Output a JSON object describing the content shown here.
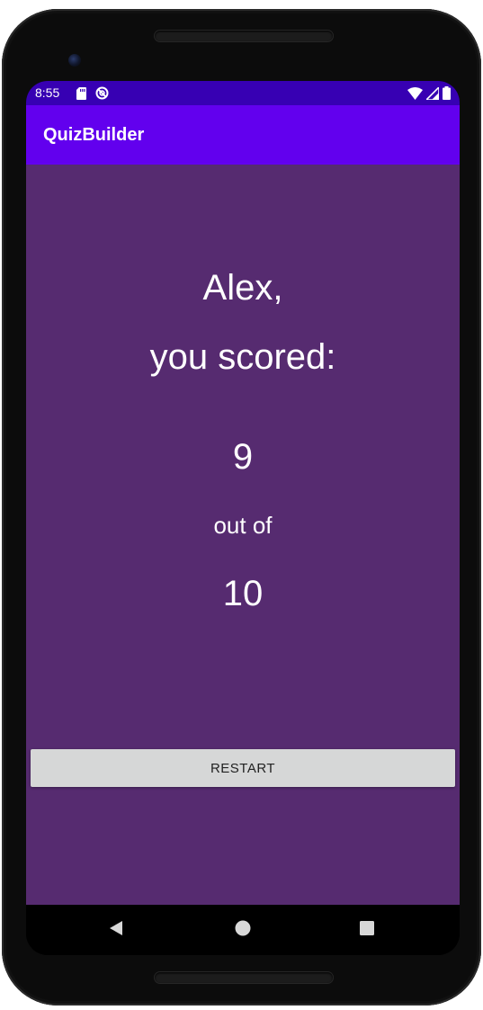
{
  "theme": {
    "status_bar_color": "#3700b3",
    "app_bar_color": "#6200ee",
    "content_color": "#562b70",
    "button_color": "#d6d7d7"
  },
  "status_bar": {
    "time": "8:55",
    "left_icons": [
      "sd-card-icon",
      "do-not-disturb-icon"
    ],
    "right_icons": [
      "wifi-icon",
      "signal-icon",
      "battery-icon"
    ]
  },
  "app_bar": {
    "title": "QuizBuilder"
  },
  "result": {
    "name_line": "Alex,",
    "scored_line": "you scored:",
    "score": "9",
    "out_of": "out of",
    "total": "10"
  },
  "actions": {
    "restart_label": "RESTART"
  },
  "nav_bar": {
    "buttons": [
      "back-icon",
      "home-icon",
      "recents-icon"
    ]
  }
}
